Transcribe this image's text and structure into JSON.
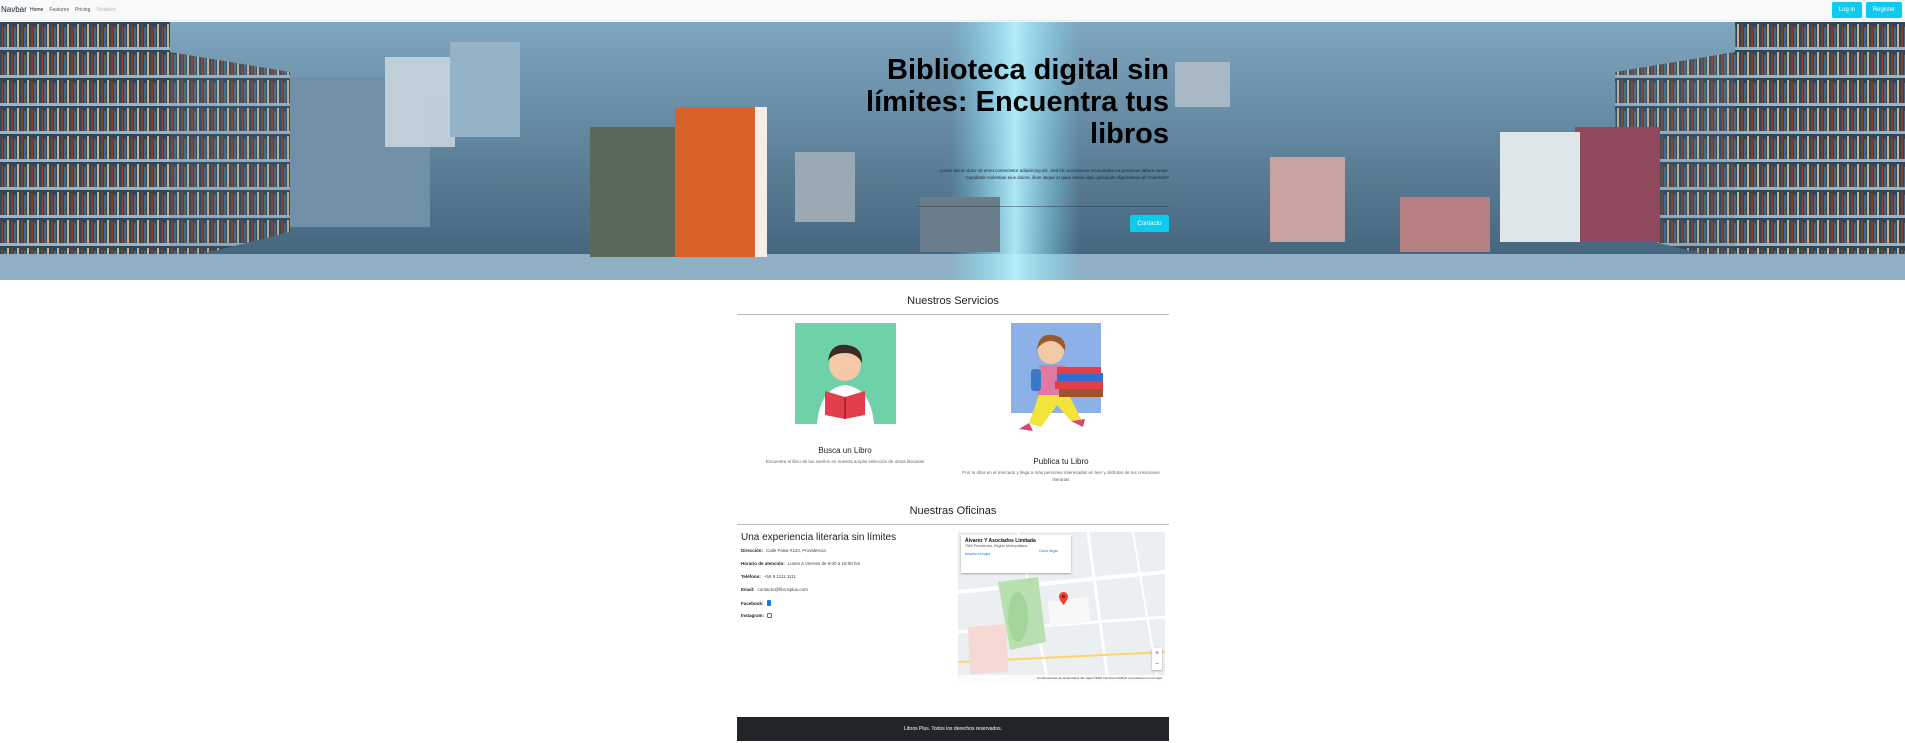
{
  "navbar": {
    "brand": "Navbar",
    "links": [
      "Home",
      "Features",
      "Pricing",
      "Disabled"
    ],
    "login": "Log in",
    "register": "Register"
  },
  "hero": {
    "title": "Biblioteca digital sin límites: Encuentra tus libros",
    "lorem": "Lorem ipsum dolor sit amet consectetur adipisicing elit. Sed hic accusamus recusandae ea possimus labore saepe. Cupiditate molestiae eius dolore, illum itaque et quas omnis iusto quisquam dignissimos ab inventore?",
    "contact_button": "Contacto"
  },
  "services": {
    "title": "Nuestros Servicios",
    "items": [
      {
        "title": "Busca un Libro",
        "text": "Encuentra el libro de tus sueños en nuestra amplia selección de obras literarias"
      },
      {
        "title": "Publica tu Libro",
        "text": "Pon tu obra en el mercado y llega a más personas interesadas en leer y disfrutar de tus creaciones literarias"
      }
    ]
  },
  "offices": {
    "title": "Nuestras Oficinas",
    "heading": "Una experiencia literaria sin límites",
    "rows": [
      {
        "label": "Dirección:",
        "value": "Calle Falsa #123, Providencia"
      },
      {
        "label": "Horario de atención:",
        "value": "Lunes a Viernes de 9:00 a 18:00 hrs"
      },
      {
        "label": "Teléfono:",
        "value": "+56 9 1111 1111"
      },
      {
        "label": "Email:",
        "value": "contacto@librosplus.com"
      },
      {
        "label": "Facebook:",
        "value": ""
      },
      {
        "label": "Instagram:",
        "value": ""
      }
    ],
    "map": {
      "place": "Álvarez Y Asociados Limitada",
      "address": "7500 Providencia, Región Metropolitana",
      "link": "Ampliar el mapa",
      "directions": "Cómo llegar",
      "footer": "Combinaciones de teclas   Datos del mapa ©2024   Términos   Notificar un problema con el mapa"
    }
  },
  "footer": {
    "text": "Libros Plus. Todos los derechos reservados."
  },
  "colors": {
    "accent": "#0dcaf0",
    "footer_bg": "#212529",
    "navbar_bg": "#f8f9fa"
  }
}
